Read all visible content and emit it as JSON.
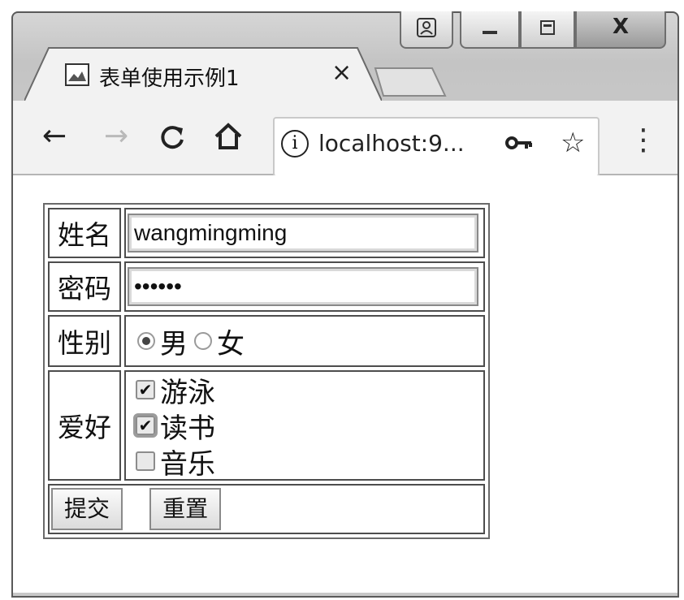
{
  "window": {
    "caption_user_icon": "user-icon",
    "caption_min_icon": "minimize-icon",
    "caption_max_icon": "maximize-icon",
    "caption_close_label": "X"
  },
  "tab": {
    "title": "表单使用示例1",
    "close_label": "×"
  },
  "toolbar": {
    "back_label": "←",
    "forward_label": "→",
    "reload_label": "C",
    "home_label": "⌂",
    "info_label": "i",
    "url": "localhost:9...",
    "key_label": "⊶",
    "star_label": "☆",
    "menu_label": "⋮"
  },
  "form": {
    "name_label": "姓名",
    "name_value": "wangmingming",
    "password_label": "密码",
    "password_value": "••••••",
    "gender_label": "性别",
    "gender_options": [
      {
        "label": "男",
        "checked": true
      },
      {
        "label": "女",
        "checked": false
      }
    ],
    "hobby_label": "爱好",
    "hobby_options": [
      {
        "label": "游泳",
        "checked": true
      },
      {
        "label": "读书",
        "checked": true
      },
      {
        "label": "音乐",
        "checked": false
      }
    ],
    "submit_label": "提交",
    "reset_label": "重置"
  }
}
